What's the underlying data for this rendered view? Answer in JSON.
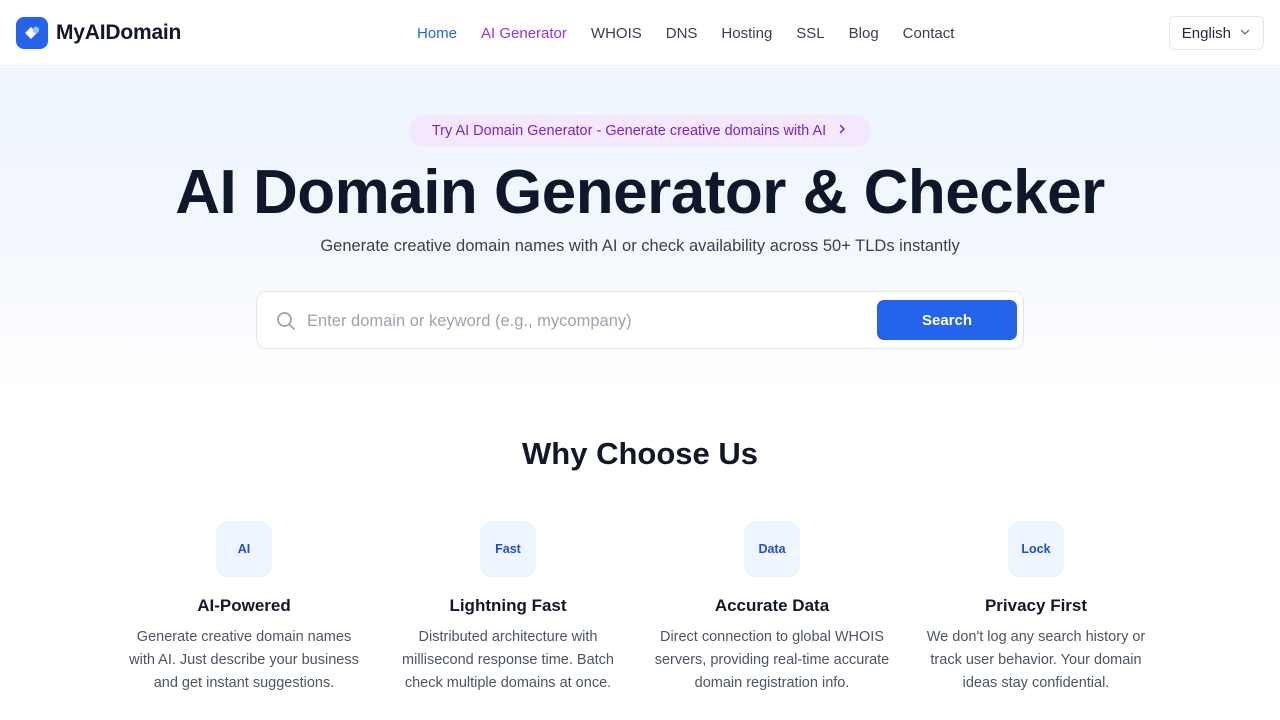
{
  "brand": {
    "name": "MyAIDomain",
    "logo_icon": "diamond-logo-icon",
    "color": "#2563eb"
  },
  "nav": {
    "items": [
      {
        "label": "Home",
        "state": "active"
      },
      {
        "label": "AI Generator",
        "state": "highlight"
      },
      {
        "label": "WHOIS"
      },
      {
        "label": "DNS"
      },
      {
        "label": "Hosting"
      },
      {
        "label": "SSL"
      },
      {
        "label": "Blog"
      },
      {
        "label": "Contact"
      }
    ]
  },
  "language": {
    "selected": "English",
    "icon": "chevron-down-icon"
  },
  "hero": {
    "promo": "Try AI Domain Generator - Generate creative domains with AI",
    "title": "AI Domain Generator & Checker",
    "subtitle": "Generate creative domain names with AI or check availability across 50+ TLDs instantly"
  },
  "search": {
    "placeholder": "Enter domain or keyword (e.g., mycompany)",
    "value": "",
    "button_label": "Search"
  },
  "features": {
    "title": "Why Choose Us",
    "items": [
      {
        "badge": "AI",
        "title": "AI-Powered",
        "desc": "Generate creative domain names with AI. Just describe your business and get instant suggestions."
      },
      {
        "badge": "Fast",
        "title": "Lightning Fast",
        "desc": "Distributed architecture with millisecond response time. Batch check multiple domains at once."
      },
      {
        "badge": "Data",
        "title": "Accurate Data",
        "desc": "Direct connection to global WHOIS servers, providing real-time accurate domain registration info."
      },
      {
        "badge": "Lock",
        "title": "Privacy First",
        "desc": "We don't log any search history or track user behavior. Your domain ideas stay confidential."
      }
    ]
  },
  "colors": {
    "accent": "#2563eb",
    "ai_purple": "#9333ea",
    "promo_bg": "#f3e8fd",
    "badge_bg": "#eff5fe"
  }
}
